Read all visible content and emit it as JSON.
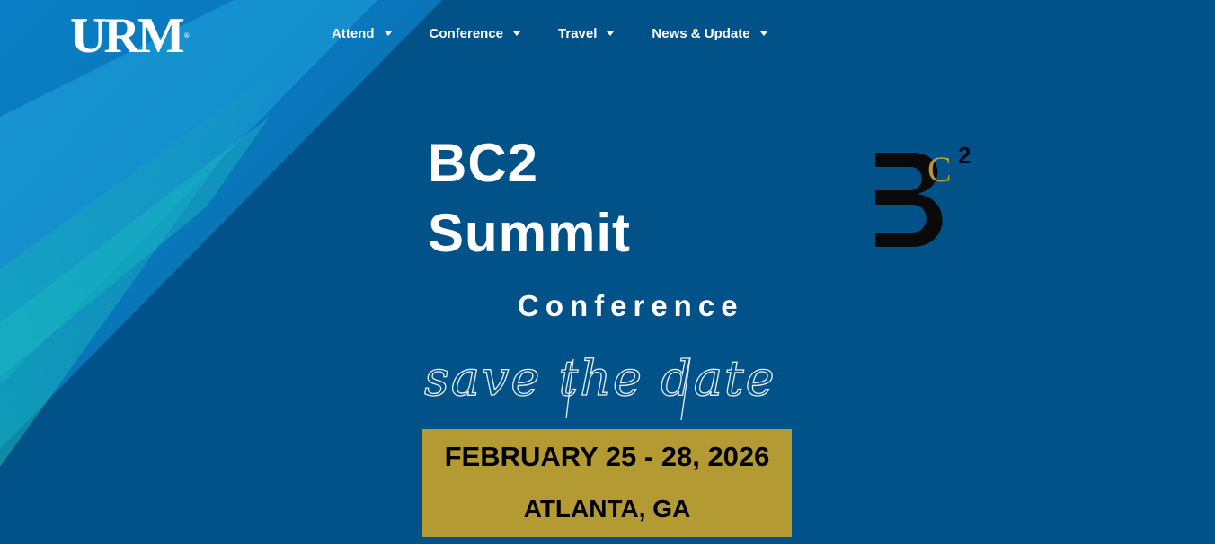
{
  "brand": {
    "logo_text": "URM",
    "logo_mark": "®"
  },
  "nav": {
    "items": [
      {
        "label": "Attend"
      },
      {
        "label": "Conference"
      },
      {
        "label": "Travel"
      },
      {
        "label": "News & Update"
      }
    ]
  },
  "hero": {
    "title_line1": "BC2",
    "title_line2": "Summit",
    "subtitle": "Conference",
    "script_text": "save the date",
    "date": "FEBRUARY 25 - 28, 2026",
    "location": "ATLANTA, GA"
  },
  "badge": {
    "letter_main": "B",
    "letter_small": "C",
    "superscript": "2"
  },
  "colors": {
    "background": "#02528a",
    "accent_gold": "#b49a33",
    "stripe_light": "#1aa6d6",
    "stripe_teal": "#12a9b0"
  }
}
